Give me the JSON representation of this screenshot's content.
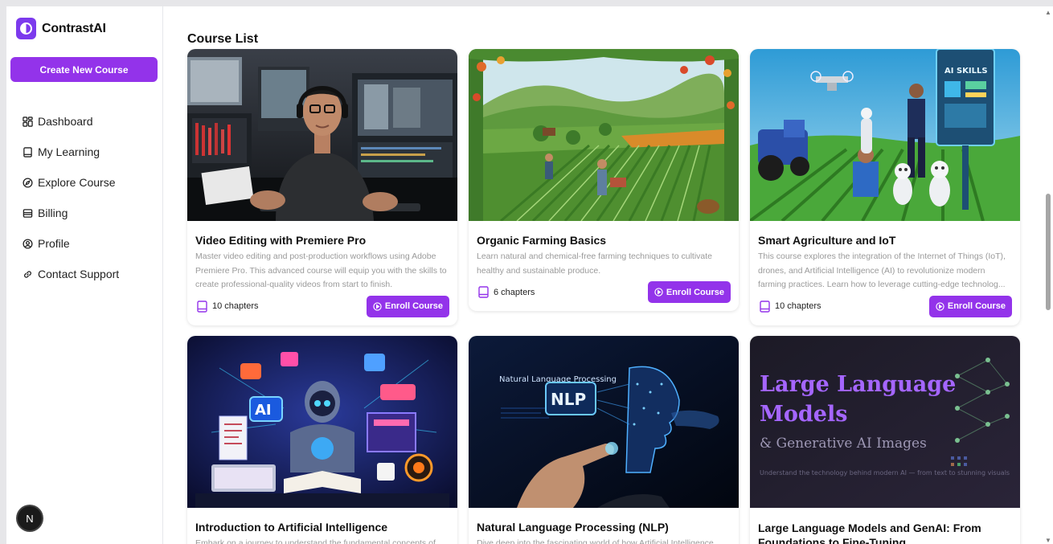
{
  "app": {
    "name": "ContrastAI"
  },
  "sidebar": {
    "create_label": "Create New Course",
    "items": [
      {
        "label": "Dashboard",
        "icon": "dashboard-grid-icon"
      },
      {
        "label": "My Learning",
        "icon": "book-icon"
      },
      {
        "label": "Explore Course",
        "icon": "compass-icon"
      },
      {
        "label": "Billing",
        "icon": "wallet-icon"
      },
      {
        "label": "Profile",
        "icon": "user-circle-icon"
      },
      {
        "label": "Contact Support",
        "icon": "link-icon"
      }
    ],
    "avatar_initial": "N"
  },
  "main": {
    "title": "Course List",
    "enroll_label": "Enroll Course",
    "courses": [
      {
        "title": "Video Editing with Premiere Pro",
        "description": "Master video editing and post-production workflows using Adobe Premiere Pro. This advanced course will equip you with the skills to create professional-quality videos from start to finish.",
        "chapters": "10 chapters"
      },
      {
        "title": "Organic Farming Basics",
        "description": "Learn natural and chemical-free farming techniques to cultivate healthy and sustainable produce.",
        "chapters": "6 chapters"
      },
      {
        "title": "Smart Agriculture and IoT",
        "description": "This course explores the integration of the Internet of Things (IoT), drones, and Artificial Intelligence (AI) to revolutionize modern farming practices. Learn how to leverage cutting-edge technolog...",
        "chapters": "10 chapters"
      },
      {
        "title": "Introduction to Artificial Intelligence",
        "description": "Embark on a journey to understand the fundamental concepts of",
        "chapters": ""
      },
      {
        "title": "Natural Language Processing (NLP)",
        "description": "Dive deep into the fascinating world of how Artificial Intelligence",
        "chapters": ""
      },
      {
        "title": "Large Language Models and GenAI: From Foundations to Fine-Tuning",
        "description": "",
        "chapters": ""
      }
    ],
    "thumb_text": {
      "smart_ag_sign": "AI SKILLS",
      "ai_badge": "AI",
      "nlp_badge": "NLP",
      "nlp_caption": "Natural Language Processing",
      "llm_line1": "Large Language",
      "llm_line2": "Models",
      "llm_line3": "& Generative AI Images",
      "llm_tagline": "Understand the technology behind modern AI — from text to stunning visuals"
    }
  },
  "colors": {
    "accent": "#9333ea",
    "brand": "#7c3aed"
  }
}
